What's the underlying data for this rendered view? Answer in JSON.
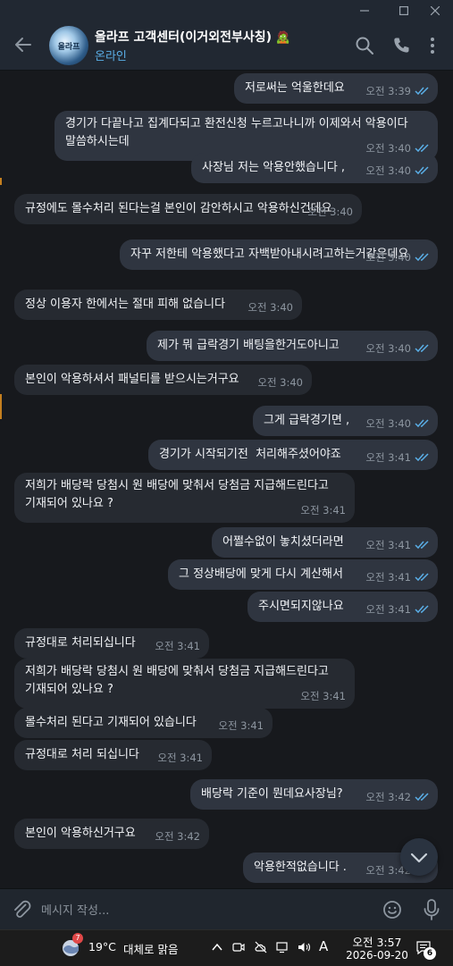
{
  "window": {
    "minimize_icon": "minimize-icon",
    "maximize_icon": "maximize-icon",
    "close_icon": "close-icon"
  },
  "chat": {
    "title": "올라프 고객센터(이거외전부사칭)",
    "title_emoji": "🧟",
    "status": "온라인",
    "avatar_label": "올라프",
    "accent": "#5aaee6"
  },
  "messages": [
    {
      "dir": "out",
      "text": "저로써는 억울한데요",
      "time": "오전 3:39",
      "read": true
    },
    {
      "dir": "out",
      "text": "경기가 다끝나고 집계다되고 환전신청 누르고나니까 이제와서 악용이다\n말씀하시는데",
      "time": "오전 3:40",
      "read": true
    },
    {
      "dir": "out",
      "text": "사장님 저는 악용안했습니다 ,",
      "time": "오전 3:40",
      "read": true
    },
    {
      "dir": "in",
      "text": "규정에도 몰수처리 된다는걸 본인이 감안하시고 악용하신건데요",
      "time": "오전 3:40"
    },
    {
      "dir": "out",
      "text": "자꾸 저한테 악용했다고 자백받아내시려고하는거같은데요",
      "time": "오전 3:40",
      "read": true
    },
    {
      "dir": "in",
      "text": "정상 이용자 한에서는 절대 피해 없습니다",
      "time": "오전 3:40"
    },
    {
      "dir": "out",
      "text": "제가 뭐 급락경기 배팅을한거도아니고",
      "time": "오전 3:40",
      "read": true
    },
    {
      "dir": "in",
      "text": "본인이 악용하셔서 패널티를 받으시는거구요",
      "time": "오전 3:40"
    },
    {
      "dir": "out",
      "text": "그게 급락경기면 ,",
      "time": "오전 3:40",
      "read": true
    },
    {
      "dir": "out",
      "text": "경기가 시작되기전  처리해주셨어야죠",
      "time": "오전 3:41",
      "read": true
    },
    {
      "dir": "in",
      "text": "저희가 배당락 당첨시 원 배당에 맞춰서 당첨금 지급해드린다고\n기재되어 있나요 ?",
      "time": "오전 3:41"
    },
    {
      "dir": "out",
      "text": "어쩔수없이 놓치셨더라면",
      "time": "오전 3:41",
      "read": true
    },
    {
      "dir": "out",
      "text": "그 정상배당에 맞게 다시 계산해서",
      "time": "오전 3:41",
      "read": true
    },
    {
      "dir": "out",
      "text": "주시면되지않나요",
      "time": "오전 3:41",
      "read": true
    },
    {
      "dir": "in",
      "text": "규정대로 처리되십니다",
      "time": "오전 3:41"
    },
    {
      "dir": "in",
      "text": "저희가 배당락 당첨시 원 배당에 맞춰서 당첨금 지급해드린다고\n기재되어 있나요 ?",
      "time": "오전 3:41"
    },
    {
      "dir": "in",
      "text": "몰수처리 된다고 기재되어 있습니다",
      "time": "오전 3:41"
    },
    {
      "dir": "in",
      "text": "규정대로 처리 되십니다",
      "time": "오전 3:41"
    },
    {
      "dir": "out",
      "text": "배당락 기준이 뭔데요사장님?",
      "time": "오전 3:42",
      "read": true
    },
    {
      "dir": "in",
      "text": "본인이 악용하신거구요",
      "time": "오전 3:42"
    },
    {
      "dir": "out",
      "text": "악용한적없습니다 .",
      "time": "오전 3:42",
      "read": true
    }
  ],
  "composer": {
    "placeholder": "메시지 작성...",
    "attach_icon": "paperclip-icon",
    "emoji_icon": "emoji-icon",
    "mic_icon": "microphone-icon"
  },
  "taskbar": {
    "weather_temp": "19°C",
    "weather_text": "대체로 맑음",
    "weather_badge": "7",
    "ime": "A",
    "time": "오전 3:57",
    "date": "2026-09-20",
    "notification_count": "6"
  }
}
